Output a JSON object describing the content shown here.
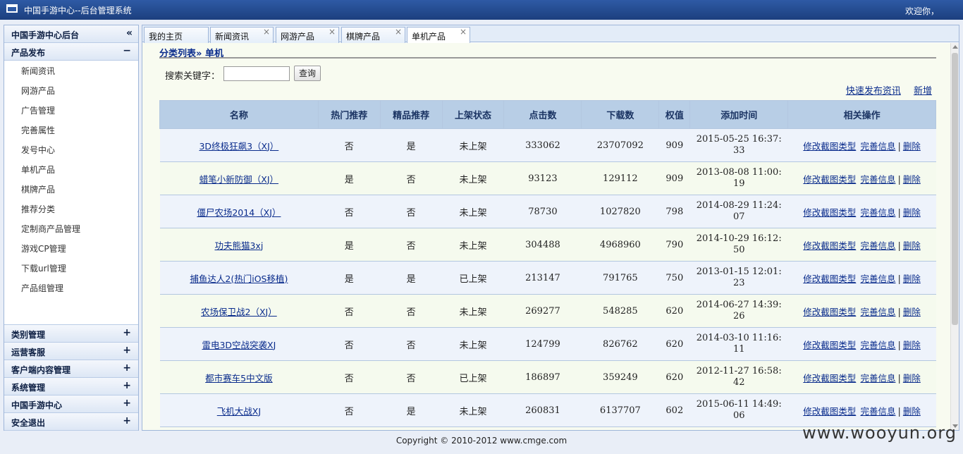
{
  "window": {
    "title": "中国手游中心--后台管理系统",
    "welcome": "欢迎你，"
  },
  "sidebar": {
    "header": "中国手游中心后台",
    "collapse_glyph": "«",
    "open_section": {
      "label": "产品发布",
      "toggle": "−"
    },
    "items": [
      {
        "label": "新闻资讯"
      },
      {
        "label": "网游产品"
      },
      {
        "label": "广告管理"
      },
      {
        "label": "完善属性"
      },
      {
        "label": "发号中心"
      },
      {
        "label": "单机产品"
      },
      {
        "label": "棋牌产品"
      },
      {
        "label": "推荐分类"
      },
      {
        "label": "定制商产品管理"
      },
      {
        "label": "游戏CP管理"
      },
      {
        "label": "下载url管理"
      },
      {
        "label": "产品组管理"
      }
    ],
    "sections": [
      {
        "label": "类别管理",
        "toggle": "+"
      },
      {
        "label": "运营客服",
        "toggle": "+"
      },
      {
        "label": "客户端内容管理",
        "toggle": "+"
      },
      {
        "label": "系统管理",
        "toggle": "+"
      },
      {
        "label": "中国手游中心",
        "toggle": "+"
      },
      {
        "label": "安全退出",
        "toggle": "+"
      }
    ]
  },
  "tabs": [
    {
      "label": "我的主页",
      "close": ""
    },
    {
      "label": "新闻资讯",
      "close": "×"
    },
    {
      "label": "网游产品",
      "close": "×"
    },
    {
      "label": "棋牌产品",
      "close": "×"
    },
    {
      "label": "单机产品",
      "close": "×",
      "active": true
    }
  ],
  "breadcrumb": {
    "parent": "分类列表",
    "separator": "»",
    "current": "单机"
  },
  "search": {
    "label": "搜索关键字：",
    "value": "",
    "placeholder": "",
    "button": "查询"
  },
  "quick_links": {
    "publish": "快速发布资讯",
    "add": "新增"
  },
  "table": {
    "headers": [
      "名称",
      "热门推荐",
      "精品推荐",
      "上架状态",
      "点击数",
      "下载数",
      "权值",
      "添加时间",
      "相关操作"
    ],
    "ops": {
      "edit_type": "修改截图类型",
      "complete": "完善信息",
      "delete": "删除",
      "sep": "|"
    },
    "rows": [
      {
        "name": "3D终极狂飙3（XJ）",
        "hot": "否",
        "fine": "是",
        "status": "未上架",
        "clicks": "333062",
        "downloads": "23707092",
        "weight": "909",
        "time": "2015-05-25 16:37:33"
      },
      {
        "name": "蜡笔小新防御（XJ）",
        "hot": "是",
        "fine": "否",
        "status": "未上架",
        "clicks": "93123",
        "downloads": "129112",
        "weight": "909",
        "time": "2013-08-08 11:00:19"
      },
      {
        "name": "僵尸农场2014（XJ）",
        "hot": "否",
        "fine": "否",
        "status": "未上架",
        "clicks": "78730",
        "downloads": "1027820",
        "weight": "798",
        "time": "2014-08-29 11:24:07"
      },
      {
        "name": "功夫熊猫3xj",
        "hot": "是",
        "fine": "否",
        "status": "未上架",
        "clicks": "304488",
        "downloads": "4968960",
        "weight": "790",
        "time": "2014-10-29 16:12:50"
      },
      {
        "name": "捕鱼达人2(热门iOS移植)",
        "hot": "是",
        "fine": "是",
        "status": "已上架",
        "clicks": "213147",
        "downloads": "791765",
        "weight": "750",
        "time": "2013-01-15 12:01:23"
      },
      {
        "name": "农场保卫战2（XJ）",
        "hot": "否",
        "fine": "否",
        "status": "未上架",
        "clicks": "269277",
        "downloads": "548285",
        "weight": "620",
        "time": "2014-06-27 14:39:26"
      },
      {
        "name": "雷电3D空战突袭XJ",
        "hot": "否",
        "fine": "否",
        "status": "未上架",
        "clicks": "124799",
        "downloads": "826762",
        "weight": "620",
        "time": "2014-03-10 11:16:11"
      },
      {
        "name": "都市赛车5中文版",
        "hot": "否",
        "fine": "否",
        "status": "已上架",
        "clicks": "186897",
        "downloads": "359249",
        "weight": "620",
        "time": "2012-11-27 16:58:42"
      },
      {
        "name": "飞机大战XJ",
        "hot": "否",
        "fine": "是",
        "status": "未上架",
        "clicks": "260831",
        "downloads": "6137707",
        "weight": "602",
        "time": "2015-06-11 14:49:06"
      }
    ]
  },
  "footer": "Copyright © 2010-2012 www.cmge.com",
  "watermark": "www.wooyun.org"
}
